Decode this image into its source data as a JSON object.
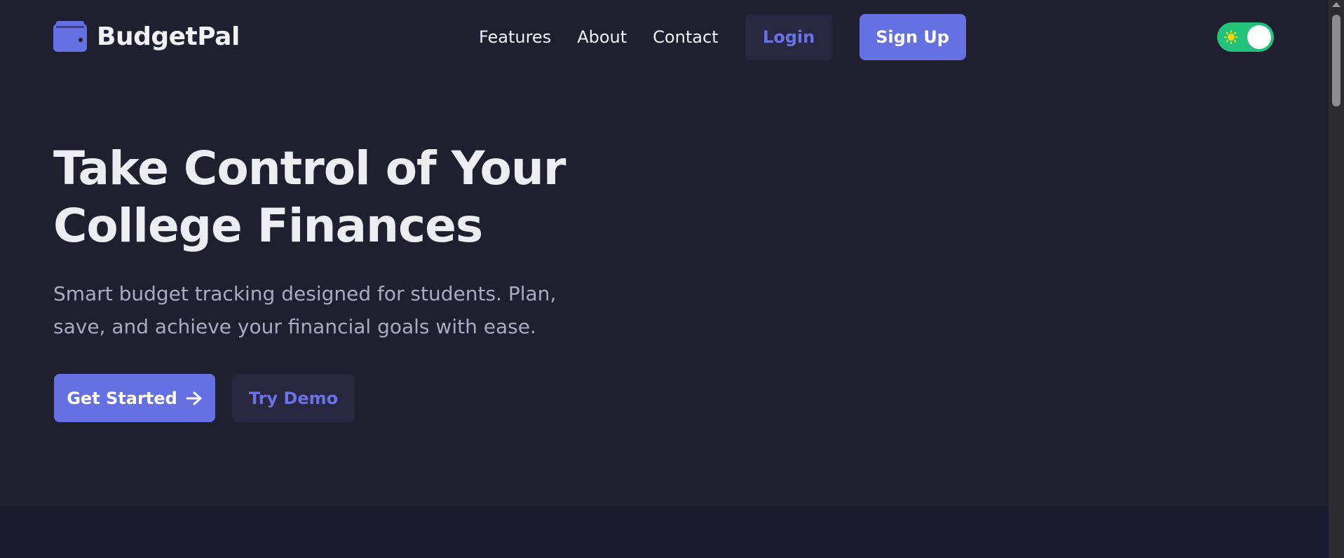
{
  "header": {
    "brand_name": "BudgetPal",
    "brand_icon": "wallet-icon",
    "nav_links": [
      "Features",
      "About",
      "Contact"
    ],
    "login_label": "Login",
    "signup_label": "Sign Up",
    "theme_toggle": {
      "icon": "sun-icon",
      "state": "on"
    }
  },
  "hero": {
    "title": "Take Control of Your College Finances",
    "subtitle": "Smart budget tracking designed for students. Plan, save, and achieve your financial goals with ease.",
    "primary_cta": "Get Started",
    "primary_cta_icon": "arrow-right-icon",
    "secondary_cta": "Try Demo"
  },
  "colors": {
    "background": "#1f1f2f",
    "accent": "#6570e2",
    "toggle_on": "#23c27a",
    "heading": "#ececf2",
    "muted_text": "#a9abc0"
  }
}
